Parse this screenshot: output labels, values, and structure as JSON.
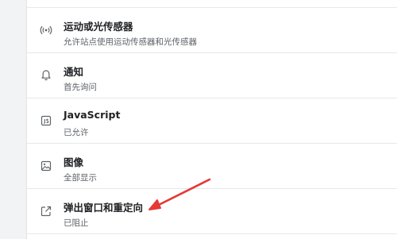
{
  "permissions": {
    "items": [
      {
        "title": "运动或光传感器",
        "subtitle": "允许站点使用运动传感器和光传感器",
        "icon": "sensors-icon"
      },
      {
        "title": "通知",
        "subtitle": "首先询问",
        "icon": "bell-icon"
      },
      {
        "title": "JavaScript",
        "subtitle": "已允许",
        "icon": "javascript-icon"
      },
      {
        "title": "图像",
        "subtitle": "全部显示",
        "icon": "image-icon"
      },
      {
        "title": "弹出窗口和重定向",
        "subtitle": "已阻止",
        "icon": "popup-redirect-icon"
      }
    ]
  },
  "annotation": {
    "color": "#e53935"
  }
}
